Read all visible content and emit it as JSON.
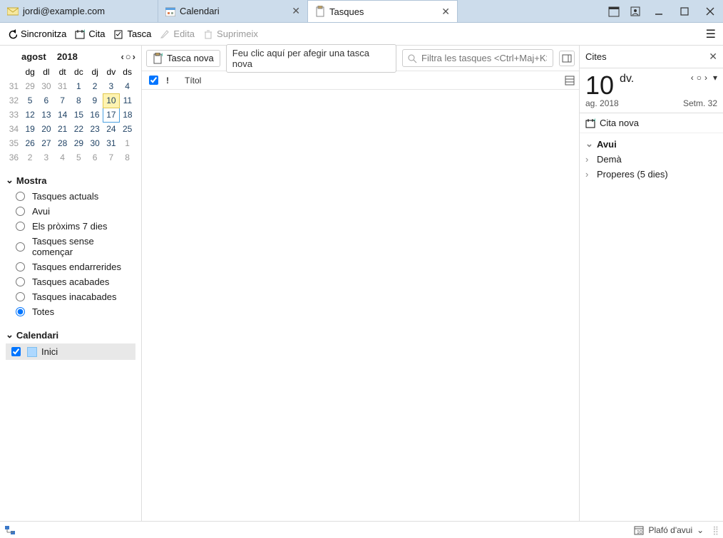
{
  "tabs": {
    "mail_label": "jordi@example.com",
    "calendar_label": "Calendari",
    "tasks_label": "Tasques"
  },
  "toolbar": {
    "sync": "Sincronitza",
    "cita": "Cita",
    "tasca": "Tasca",
    "edita": "Edita",
    "suprimeix": "Suprimeix"
  },
  "calendar": {
    "month": "agost",
    "year": "2018",
    "weekdays": [
      "dg",
      "dl",
      "dt",
      "dc",
      "dj",
      "dv",
      "ds"
    ],
    "weeks": [
      {
        "wk": "31",
        "days": [
          {
            "n": "29",
            "dim": true
          },
          {
            "n": "30",
            "dim": true
          },
          {
            "n": "31",
            "dim": true
          },
          {
            "n": "1"
          },
          {
            "n": "2"
          },
          {
            "n": "3"
          },
          {
            "n": "4"
          }
        ]
      },
      {
        "wk": "32",
        "days": [
          {
            "n": "5"
          },
          {
            "n": "6"
          },
          {
            "n": "7"
          },
          {
            "n": "8"
          },
          {
            "n": "9"
          },
          {
            "n": "10",
            "today": true
          },
          {
            "n": "11"
          }
        ]
      },
      {
        "wk": "33",
        "days": [
          {
            "n": "12"
          },
          {
            "n": "13"
          },
          {
            "n": "14"
          },
          {
            "n": "15"
          },
          {
            "n": "16"
          },
          {
            "n": "17",
            "sel": true
          },
          {
            "n": "18"
          }
        ]
      },
      {
        "wk": "34",
        "days": [
          {
            "n": "19"
          },
          {
            "n": "20"
          },
          {
            "n": "21"
          },
          {
            "n": "22"
          },
          {
            "n": "23"
          },
          {
            "n": "24"
          },
          {
            "n": "25"
          }
        ]
      },
      {
        "wk": "35",
        "days": [
          {
            "n": "26"
          },
          {
            "n": "27"
          },
          {
            "n": "28"
          },
          {
            "n": "29"
          },
          {
            "n": "30"
          },
          {
            "n": "31"
          },
          {
            "n": "1",
            "dim": true
          }
        ]
      },
      {
        "wk": "36",
        "days": [
          {
            "n": "2",
            "dim": true
          },
          {
            "n": "3",
            "dim": true
          },
          {
            "n": "4",
            "dim": true
          },
          {
            "n": "5",
            "dim": true
          },
          {
            "n": "6",
            "dim": true
          },
          {
            "n": "7",
            "dim": true
          },
          {
            "n": "8",
            "dim": true
          }
        ]
      }
    ]
  },
  "groups": {
    "mostra_hdr": "Mostra",
    "mostra_options": [
      "Tasques actuals",
      "Avui",
      "Els pròxims 7 dies",
      "Tasques sense començar",
      "Tasques endarrerides",
      "Tasques acabades",
      "Tasques inacabades",
      "Totes"
    ],
    "mostra_selected_index": 7,
    "calendari_hdr": "Calendari",
    "calendari_item": "Inici"
  },
  "mid": {
    "new_task_btn": "Tasca nova",
    "new_task_placeholder": "Feu clic aquí per afegir una tasca nova",
    "filter_placeholder": "Filtra les tasques <Ctrl+Maj+K>",
    "title_col": "Títol"
  },
  "right": {
    "pane_title": "Cites",
    "day_num": "10",
    "day_abbr": "dv.",
    "month_year": "ag. 2018",
    "week": "Setm. 32",
    "cita_nova": "Cita nova",
    "items": [
      {
        "label": "Avui",
        "bold": true,
        "expanded": true
      },
      {
        "label": "Demà",
        "bold": false,
        "expanded": false
      },
      {
        "label": "Properes (5 dies)",
        "bold": false,
        "expanded": false
      }
    ]
  },
  "status": {
    "plafo": "Plafó d'avui"
  }
}
